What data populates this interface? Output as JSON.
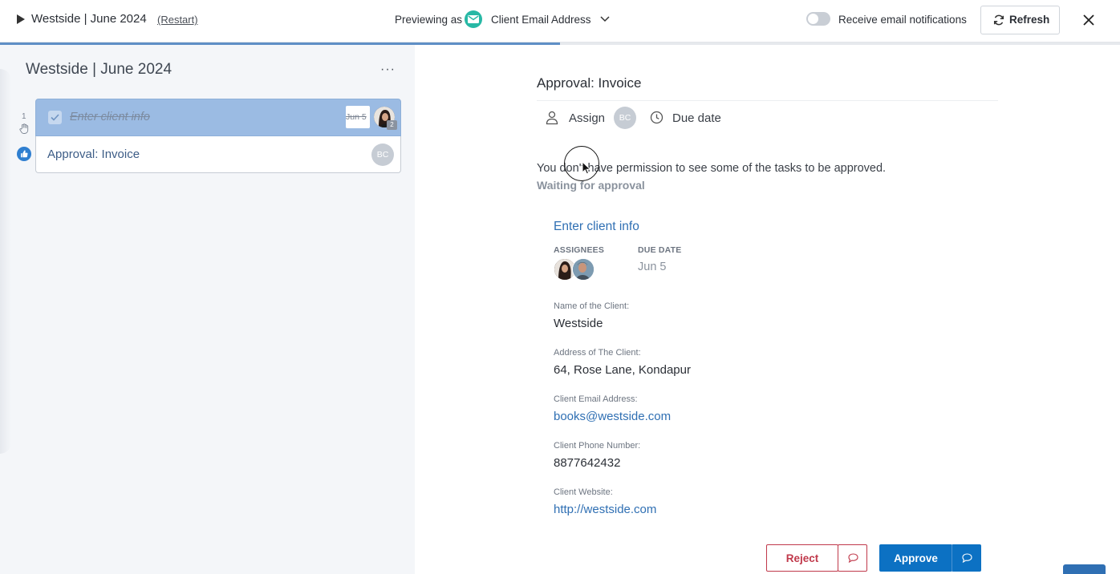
{
  "topbar": {
    "run_title": "Westside | June 2024",
    "restart_label": "(Restart)",
    "previewing_label": "Previewing as",
    "preview_value": "Client Email Address",
    "notifications_label": "Receive email notifications",
    "refresh_label": "Refresh"
  },
  "progress": {
    "fraction": 0.5
  },
  "sidebar": {
    "title": "Westside | June 2024",
    "more_label": "···",
    "row_number": "1",
    "tasks": [
      {
        "label": "Enter client info",
        "due": "Jun 5",
        "assignee_count": "2"
      },
      {
        "label": "Approval: Invoice",
        "assignee": "BC"
      }
    ]
  },
  "detail": {
    "title": "Approval: Invoice",
    "assign_label": "Assign",
    "assignee_initials": "BC",
    "due_label": "Due date",
    "permission_message": "You don't have permission to see some of the tasks to be approved.",
    "status": "Waiting for approval",
    "subtask": {
      "title": "Enter client info",
      "assignees_heading": "ASSIGNEES",
      "due_heading": "DUE DATE",
      "due_value": "Jun 5"
    },
    "fields": [
      {
        "label": "Name of the Client:",
        "value": "Westside"
      },
      {
        "label": "Address of The Client:",
        "value": "64, Rose Lane, Kondapur"
      },
      {
        "label": "Client Email Address:",
        "value": "books@westside.com"
      },
      {
        "label": "Client Phone Number:",
        "value": "8877642432"
      },
      {
        "label": "Client Website:",
        "value": "http://westside.com"
      }
    ],
    "reject_label": "Reject",
    "approve_label": "Approve"
  },
  "colors": {
    "accent": "#0c71c3",
    "reject": "#c0394b",
    "completed_task": "#9bbbe3",
    "email_icon": "#27b8a5",
    "link": "#2f6fb3"
  },
  "icons": [
    "play-icon",
    "email-icon",
    "chevron-down-icon",
    "refresh-icon",
    "close-icon",
    "more-icon",
    "checkbox-icon",
    "hand-icon",
    "thumbs-up-icon",
    "user-icon",
    "clock-icon",
    "comment-icon",
    "cursor-icon"
  ]
}
